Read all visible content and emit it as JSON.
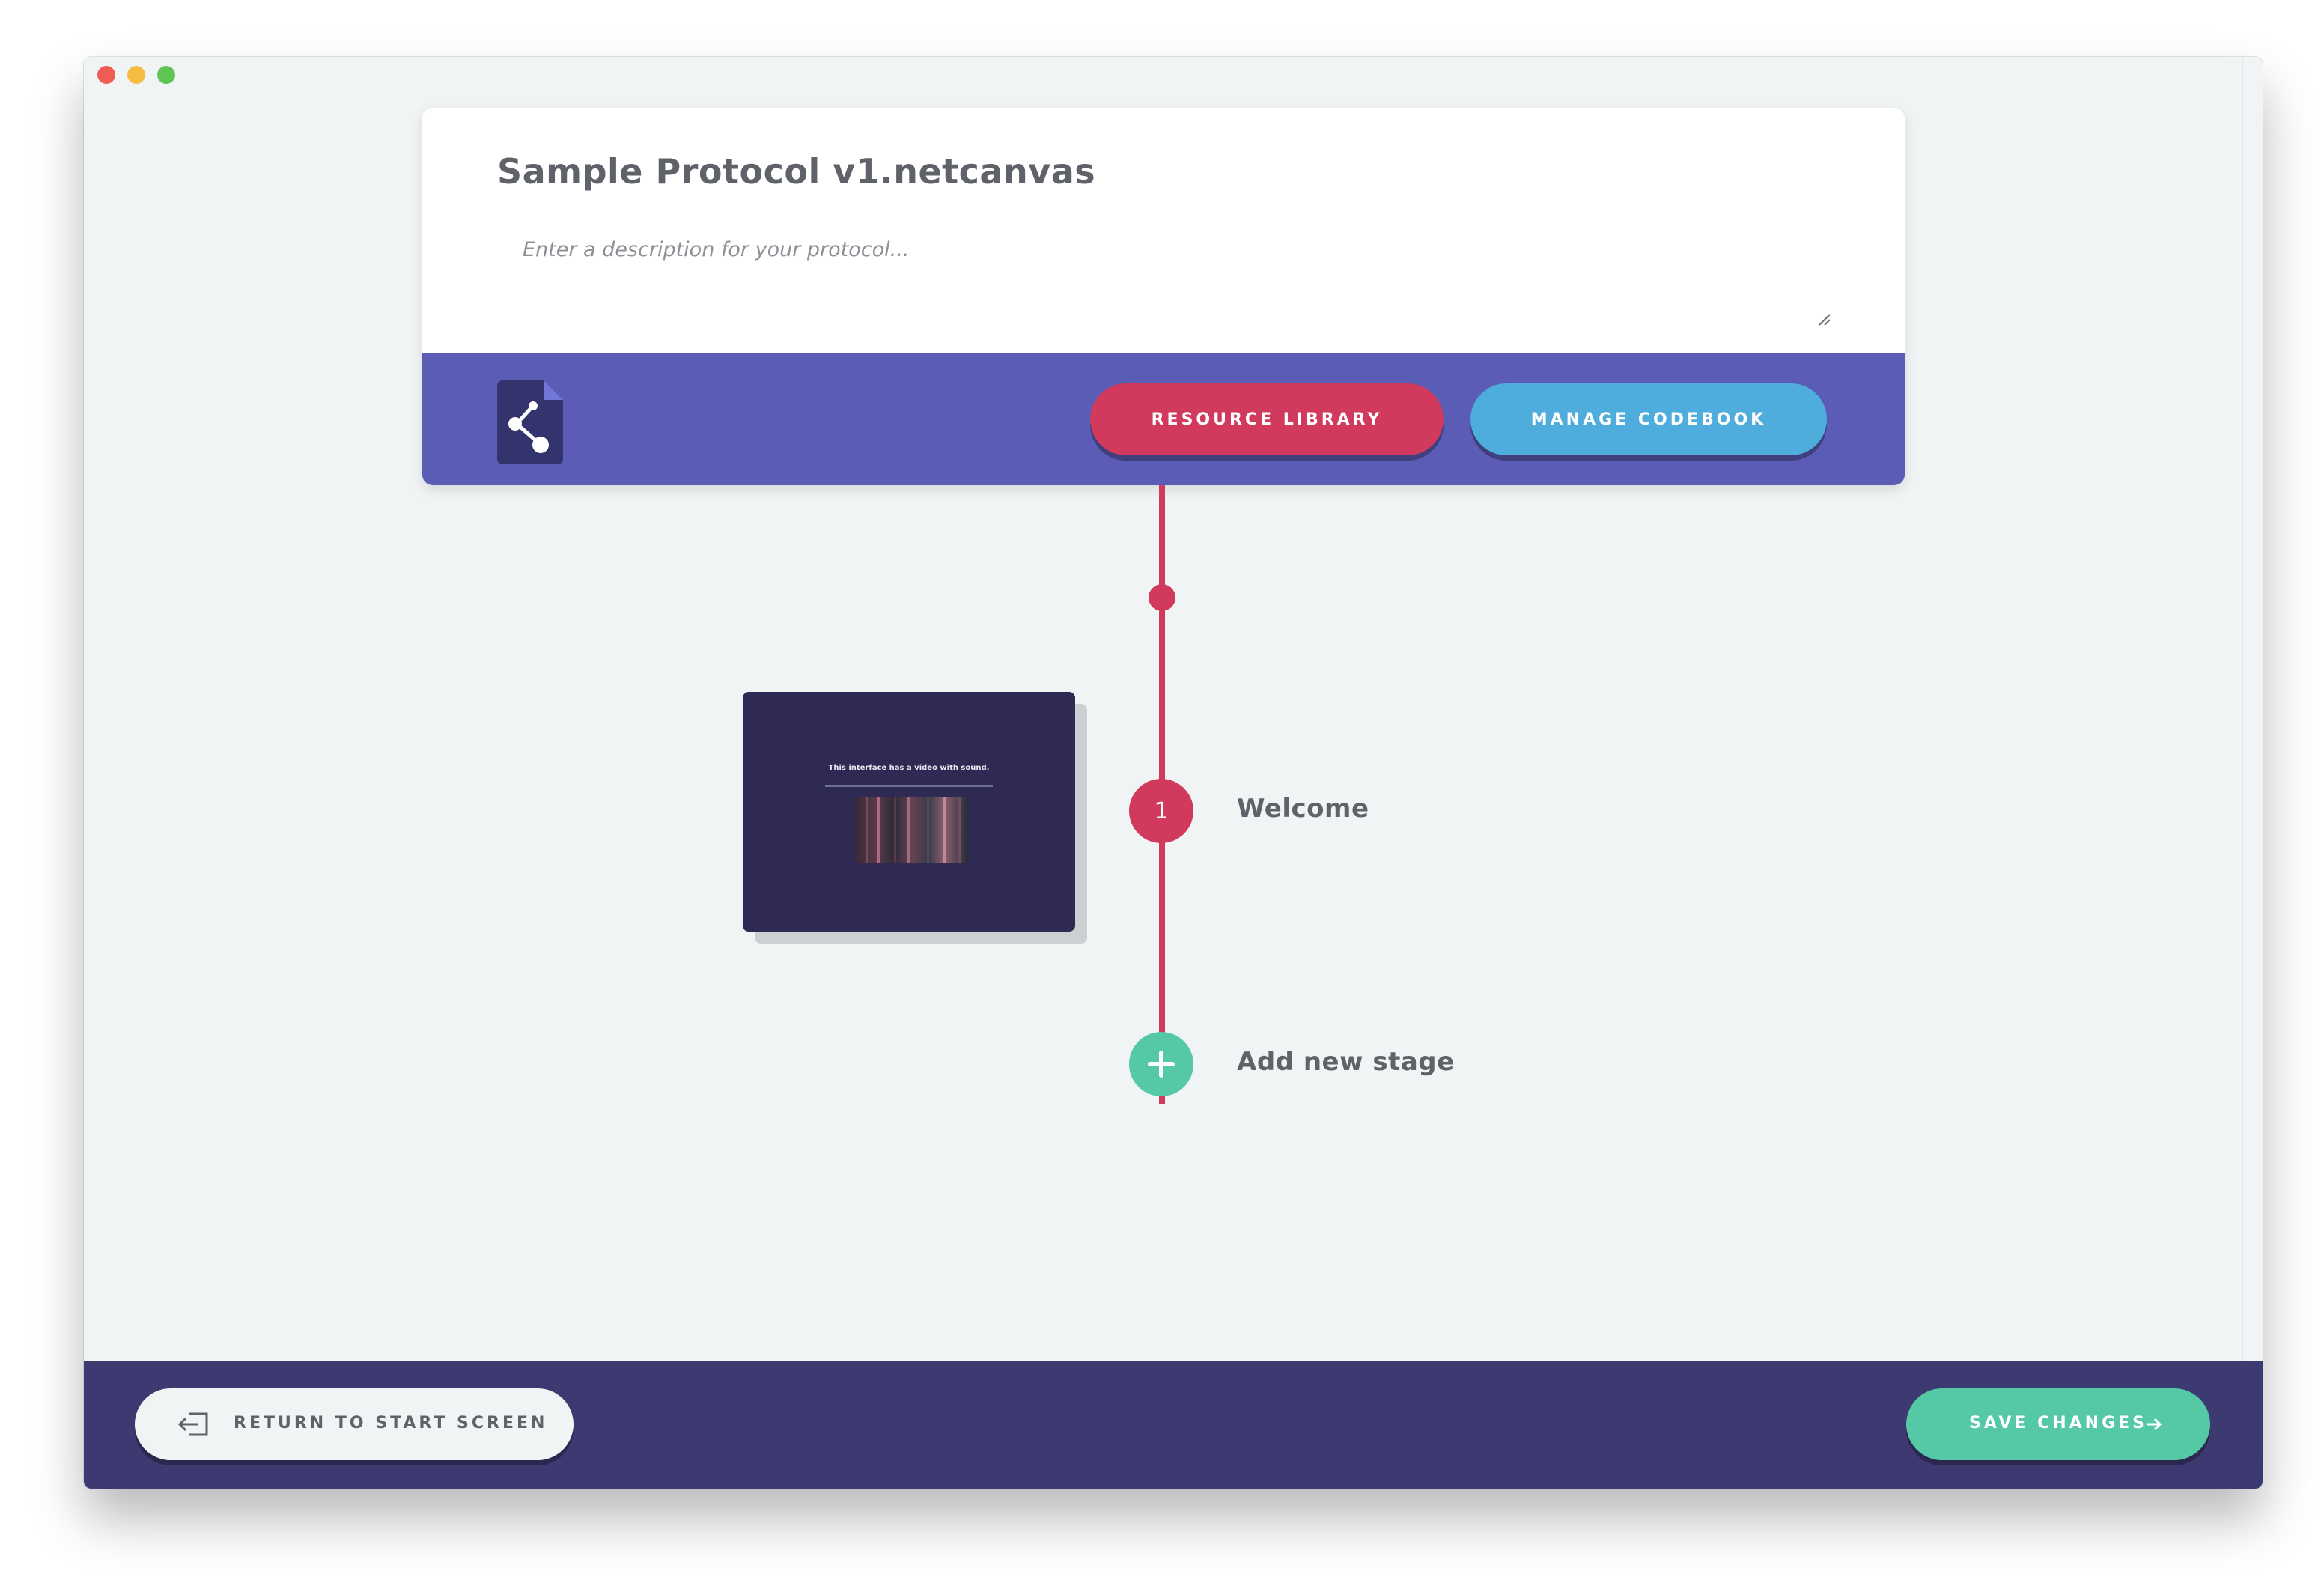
{
  "protocol": {
    "title": "Sample Protocol v1.netcanvas",
    "description_placeholder": "Enter a description for your protocol..."
  },
  "header_actions": {
    "resource_library": "RESOURCE LIBRARY",
    "manage_codebook": "MANAGE CODEBOOK"
  },
  "stages": [
    {
      "number": "1",
      "label": "Welcome",
      "preview_text": "This interface has a video with sound."
    }
  ],
  "add_stage": {
    "label": "Add new stage"
  },
  "footer": {
    "return_label": "RETURN TO START SCREEN",
    "save_label": "SAVE CHANGES"
  },
  "icons": {
    "protocol_file": "share-file-icon",
    "return": "exit-icon",
    "save": "arrow-right-icon",
    "add": "plus-icon"
  },
  "colors": {
    "primary_bar": "#5a5cb6",
    "resource_button": "#d13a5c",
    "codebook_button": "#4eaddc",
    "timeline": "#d13a5c",
    "add_stage": "#55c8a5",
    "footer": "#3c3a71",
    "save_button": "#55c8a5"
  }
}
